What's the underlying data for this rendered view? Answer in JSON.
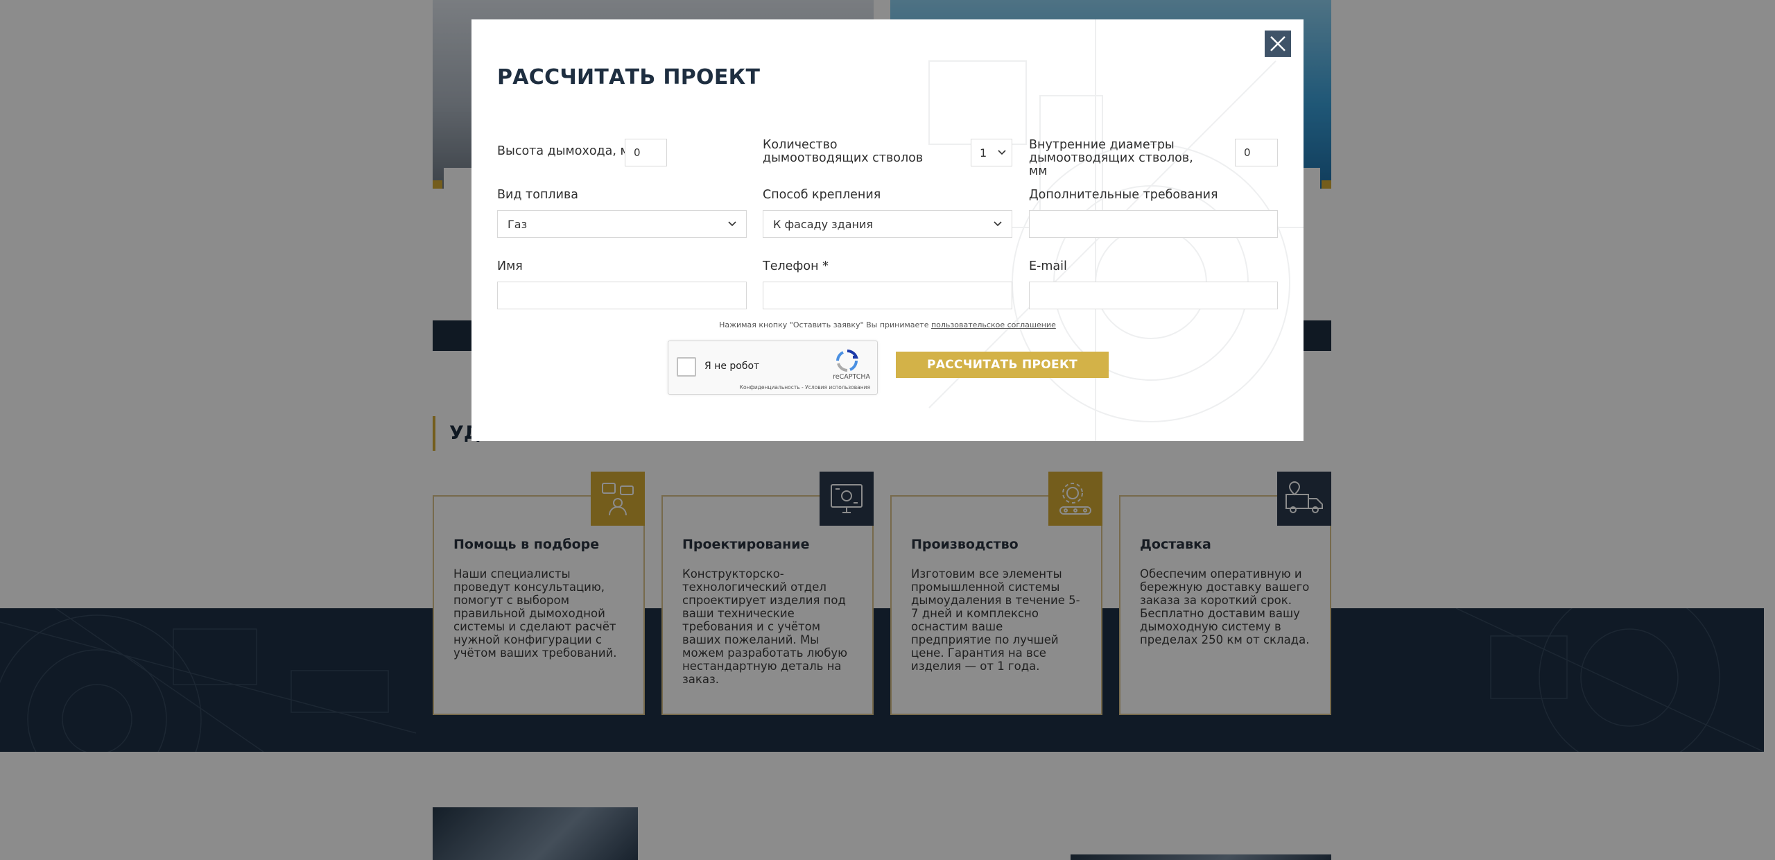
{
  "background": {
    "services_title": "УДОБНО",
    "services": [
      {
        "title": "Помощь в подборе",
        "text": "Наши специалисты проведут консультацию, помогут с выбором правильной дымоходной системы и сделают расчёт нужной конфигурации с учётом ваших требований.",
        "icon": "consultation-icon"
      },
      {
        "title": "Проектирование",
        "text": "Конструкторско-технологический отдел спроектирует изделия под ваши технические требования и с учётом ваших пожеланий. Мы можем разработать любую нестандартную деталь на заказ.",
        "icon": "design-monitor-icon"
      },
      {
        "title": "Производство",
        "text": "Изготовим все элементы промышленной системы дымоудаления в течение 5-7 дней и комплексно оснастим ваше предприятие по лучшей цене. Гарантия на все изделия — от 1 года.",
        "icon": "production-gear-icon"
      },
      {
        "title": "Доставка",
        "text": "Обеспечим оперативную и бережную доставку вашего заказа за короткий срок. Бесплатно доставим вашу дымоходную систему в пределах 250 км от склада.",
        "icon": "delivery-truck-icon"
      }
    ]
  },
  "modal": {
    "title": "РАССЧИТАТЬ ПРОЕКТ",
    "height_label": "Высота дымохода, м",
    "height_value": "0",
    "flues_label": "Количество дымоотводящих стволов",
    "flues_value": "1",
    "diameter_label": "Внутренние диаметры дымоотводящих стволов, мм",
    "diameter_value": "0",
    "fuel_label": "Вид топлива",
    "fuel_value": "Газ",
    "mount_label": "Способ крепления",
    "mount_value": "К фасаду здания",
    "extra_label": "Дополнительные требования",
    "extra_value": "",
    "name_label": "Имя",
    "name_value": "",
    "phone_label": "Телефон *",
    "phone_value": "",
    "email_label": "E-mail",
    "email_value": "",
    "agreement_text": "Нажимая кнопку \"Оставить заявку\" Вы принимаете",
    "agreement_link": "пользовательское соглашение",
    "captcha_label": "Я не робот",
    "captcha_brand": "reCAPTCHA",
    "captcha_privacy": "Конфиденциальность",
    "captcha_separator": " - ",
    "captcha_terms": "Условия использования",
    "submit_label": "РАССЧИТАТЬ ПРОЕКТ"
  },
  "colors": {
    "navy": "#1e2e40",
    "gold": "#d3a934",
    "button_gold": "#d3b248",
    "close_bg": "#3f5368"
  }
}
